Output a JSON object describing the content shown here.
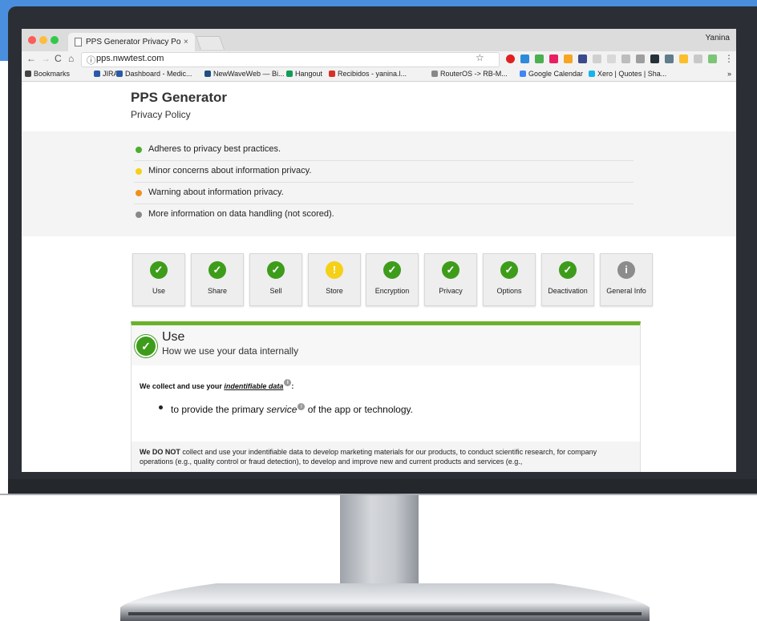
{
  "browser": {
    "tab_title": "PPS Generator Privacy Policy",
    "tab_close": "×",
    "user_name": "Yanina",
    "url": "pps.nwwtest.com",
    "nav": {
      "back": "←",
      "forward": "→",
      "reload": "C",
      "home": "⌂",
      "info": "ⓘ",
      "star": "☆",
      "menu": "⋮"
    },
    "bookmarks": [
      {
        "label": "Bookmarks",
        "icon": "star-icon",
        "color": "#444444"
      },
      {
        "label": "JIRA",
        "icon": "jira-icon",
        "color": "#2a5aa8"
      },
      {
        "label": "Dashboard - Medic...",
        "icon": "jira-icon",
        "color": "#2a5aa8"
      },
      {
        "label": "NewWaveWeb — Bi...",
        "icon": "bitbucket-icon",
        "color": "#205081"
      },
      {
        "label": "Hangout",
        "icon": "hangout-icon",
        "color": "#0f9d58"
      },
      {
        "label": "Recibidos - yanina.l...",
        "icon": "gmail-icon",
        "color": "#d93025"
      },
      {
        "label": "RouterOS -> RB-M...",
        "icon": "document-icon",
        "color": "#888888"
      },
      {
        "label": "Google Calendar",
        "icon": "calendar-icon",
        "color": "#4285f4"
      },
      {
        "label": "Xero | Quotes | Sha...",
        "icon": "xero-icon",
        "color": "#13b5ea"
      }
    ],
    "bookmarks_overflow": "»"
  },
  "header": {
    "title": "PPS Generator",
    "subtitle": "Privacy Policy"
  },
  "legend": [
    {
      "text": "Adheres to privacy best practices.",
      "color": "#4cae2a"
    },
    {
      "text": "Minor concerns about information privacy.",
      "color": "#f5d018"
    },
    {
      "text": "Warning about information privacy.",
      "color": "#f0901a"
    },
    {
      "text": "More information on data handling (not scored).",
      "color": "#888888"
    }
  ],
  "categories": [
    {
      "label": "Use",
      "status": "good",
      "symbol": "✓",
      "color": "#3e9c1b"
    },
    {
      "label": "Share",
      "status": "good",
      "symbol": "✓",
      "color": "#3e9c1b"
    },
    {
      "label": "Sell",
      "status": "good",
      "symbol": "✓",
      "color": "#3e9c1b"
    },
    {
      "label": "Store",
      "status": "minor",
      "symbol": "!",
      "color": "#f5d018"
    },
    {
      "label": "Encryption",
      "status": "good",
      "symbol": "✓",
      "color": "#3e9c1b"
    },
    {
      "label": "Privacy",
      "status": "good",
      "symbol": "✓",
      "color": "#3e9c1b"
    },
    {
      "label": "Options",
      "status": "good",
      "symbol": "✓",
      "color": "#3e9c1b"
    },
    {
      "label": "Deactivation",
      "status": "good",
      "symbol": "✓",
      "color": "#3e9c1b"
    },
    {
      "label": "General Info",
      "status": "info",
      "symbol": "i",
      "color": "#8c8c8c"
    }
  ],
  "panel": {
    "badge": "✓",
    "title": "Use",
    "subtitle": "How we use your data internally",
    "collect_prefix": "We collect and use your ",
    "collect_term": "indentifiable data",
    "collect_suffix": ":",
    "info_symbol": "i",
    "bullet_prefix": "to provide the primary ",
    "bullet_term": "service",
    "bullet_suffix": " of the app or technology.",
    "donot_bold": "We DO NOT",
    "donot_text": " collect and use your indentifiable data to develop marketing materials for our products, to conduct scientific research, for company operations (e.g., quality control or fraud detection), to develop and improve new and current products and services (e.g.,"
  }
}
